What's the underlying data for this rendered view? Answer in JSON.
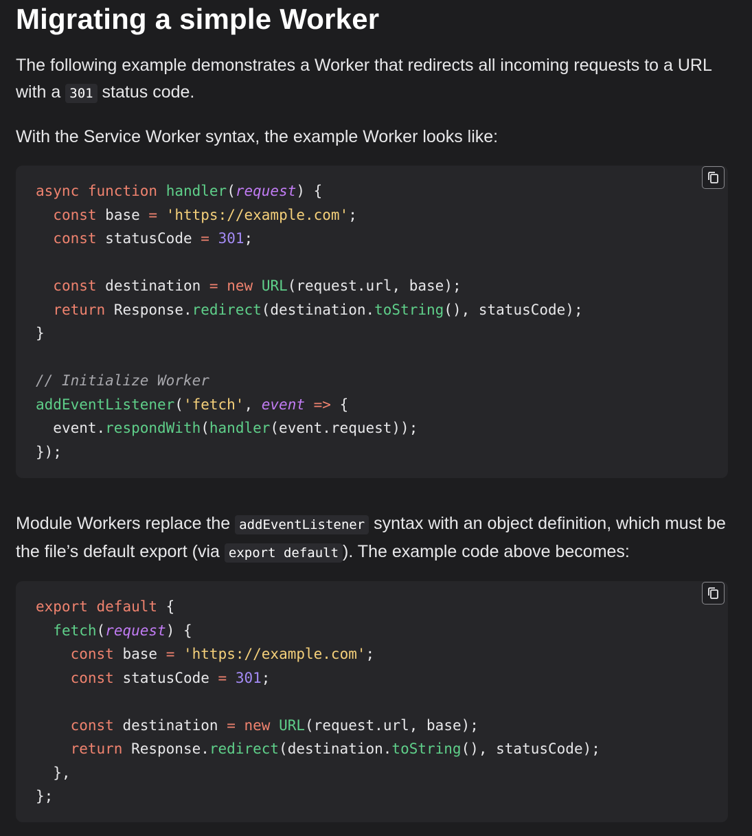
{
  "heading": "Migrating a simple Worker",
  "intro": {
    "before": "The following example demonstrates a Worker that redirects all incoming requests to a URL with a",
    "code": "301",
    "after": "status code."
  },
  "sw_intro": "With the Service Worker syntax, the example Worker looks like:",
  "module_intro": {
    "part1": "Module Workers replace the",
    "code1": "addEventListener",
    "part2": "syntax with an object definition, which must be the file’s default export (via",
    "code2": "export default",
    "part3": "). The example code above becomes:"
  },
  "copy_icon": "copy-icon",
  "tokens": {
    "async": "async",
    "function": "function",
    "handler": "handler",
    "request": "request",
    "const": "const",
    "base_var": "base",
    "url_string": "'https://example.com'",
    "statusCode_var": "statusCode",
    "status_value": "301",
    "destination_var": "destination",
    "new": "new",
    "URL": "URL",
    "ctor_args": "(request.url, base);",
    "return": "return",
    "Response": "Response.",
    "redirect": "redirect",
    "dest_dot": "(destination.",
    "toString": "toString",
    "redirect_tail": "(), statusCode);",
    "comment": "// Initialize Worker",
    "addEventListener": "addEventListener",
    "fetch_string": "'fetch'",
    "event": "event",
    "arrow": "=>",
    "event_dot": "event.",
    "respondWith": "respondWith",
    "event_request": "(event.request));",
    "export": "export",
    "default": "default",
    "fetch": "fetch"
  },
  "colors": {
    "background": "#1d1d1f",
    "code_background": "#262629",
    "keyword": "#f0836f",
    "function": "#5fd08a",
    "parameter": "#c27cf5",
    "string": "#f5d07a",
    "number": "#a48bf5",
    "comment": "#a8a8ad"
  }
}
